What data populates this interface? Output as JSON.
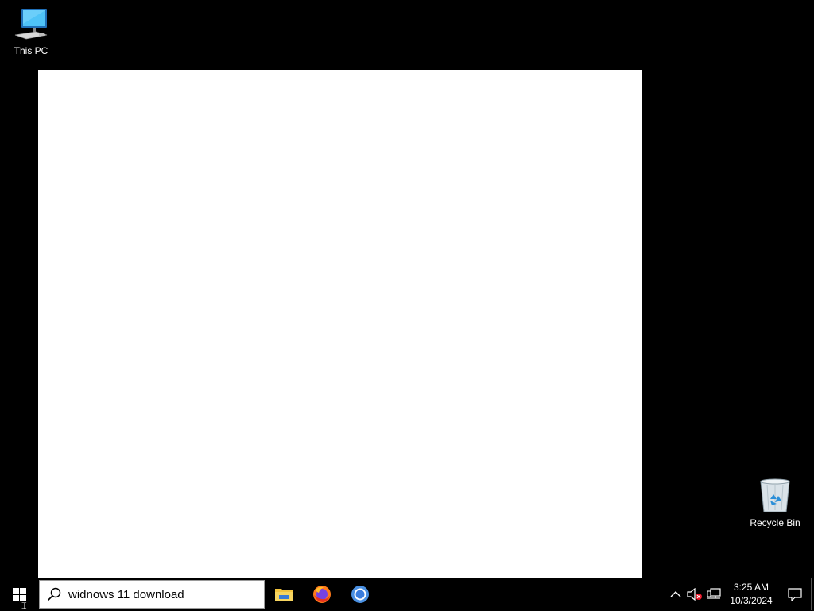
{
  "desktop": {
    "icons": [
      {
        "label": "This PC",
        "icon": "computer-icon"
      },
      {
        "label": "Recycle Bin",
        "icon": "recycle-bin-icon"
      }
    ]
  },
  "taskbar": {
    "start_icon": "windows-logo-icon",
    "search": {
      "value": "widnows 11 download",
      "icon": "search-icon"
    },
    "pinned_apps": [
      {
        "name": "File Explorer",
        "icon": "folder-icon"
      },
      {
        "name": "Firefox",
        "icon": "firefox-icon"
      },
      {
        "name": "Chrome",
        "icon": "chrome-icon"
      }
    ],
    "tray": {
      "chevron_icon": "chevron-up-icon",
      "volume_icon": "volume-muted-icon",
      "network_icon": "network-icon",
      "time": "3:25 AM",
      "date": "10/3/2024",
      "notification_icon": "notification-icon"
    }
  },
  "colors": {
    "background": "#000000",
    "popup": "#ffffff",
    "monitor_blue": "#2f9fe8"
  }
}
